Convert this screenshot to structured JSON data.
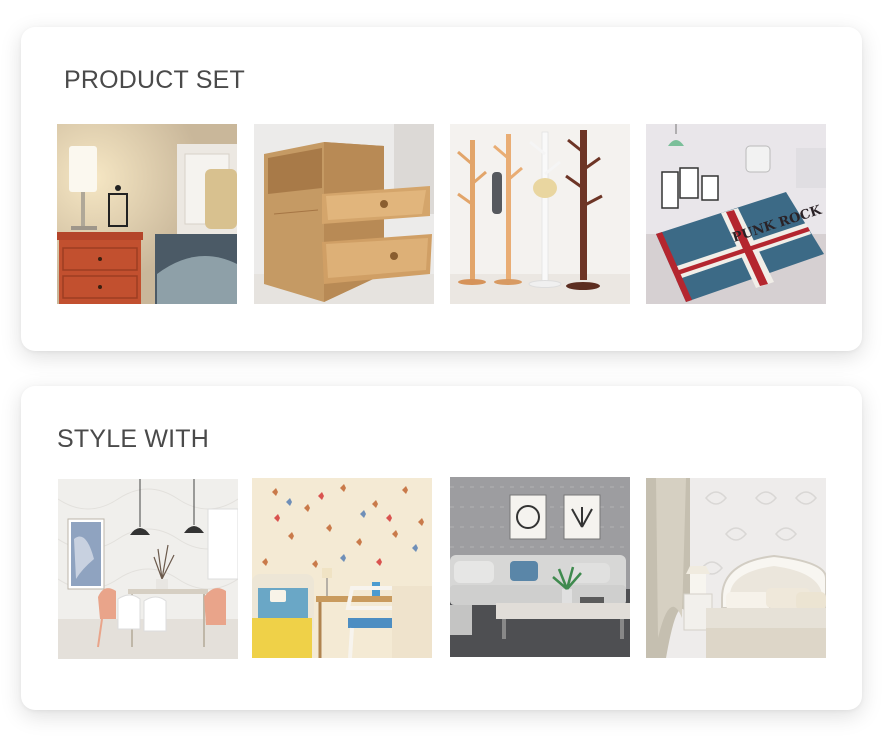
{
  "product_set": {
    "title": "PRODUCT SET",
    "items": [
      {
        "name": "product-thumb-table-lamp-nightstand",
        "icon": "nightstand-with-lamp-image"
      },
      {
        "name": "product-thumb-wooden-drawer-cabinet",
        "icon": "drawer-cabinet-image"
      },
      {
        "name": "product-thumb-coat-racks",
        "icon": "coat-rack-image"
      },
      {
        "name": "product-thumb-union-jack-rug",
        "icon": "union-jack-rug-image",
        "text": "PUNK ROCK"
      }
    ]
  },
  "style_with": {
    "title": "STYLE WITH",
    "items": [
      {
        "name": "style-thumb-dining-room",
        "icon": "dining-room-image"
      },
      {
        "name": "style-thumb-butterfly-wallpaper",
        "icon": "butterfly-wallpaper-room-image"
      },
      {
        "name": "style-thumb-grey-living-room",
        "icon": "living-room-image"
      },
      {
        "name": "style-thumb-damask-bedroom",
        "icon": "bedroom-image"
      }
    ]
  },
  "colors": {
    "title_text": "#4a4a4a",
    "card_background": "#ffffff"
  }
}
